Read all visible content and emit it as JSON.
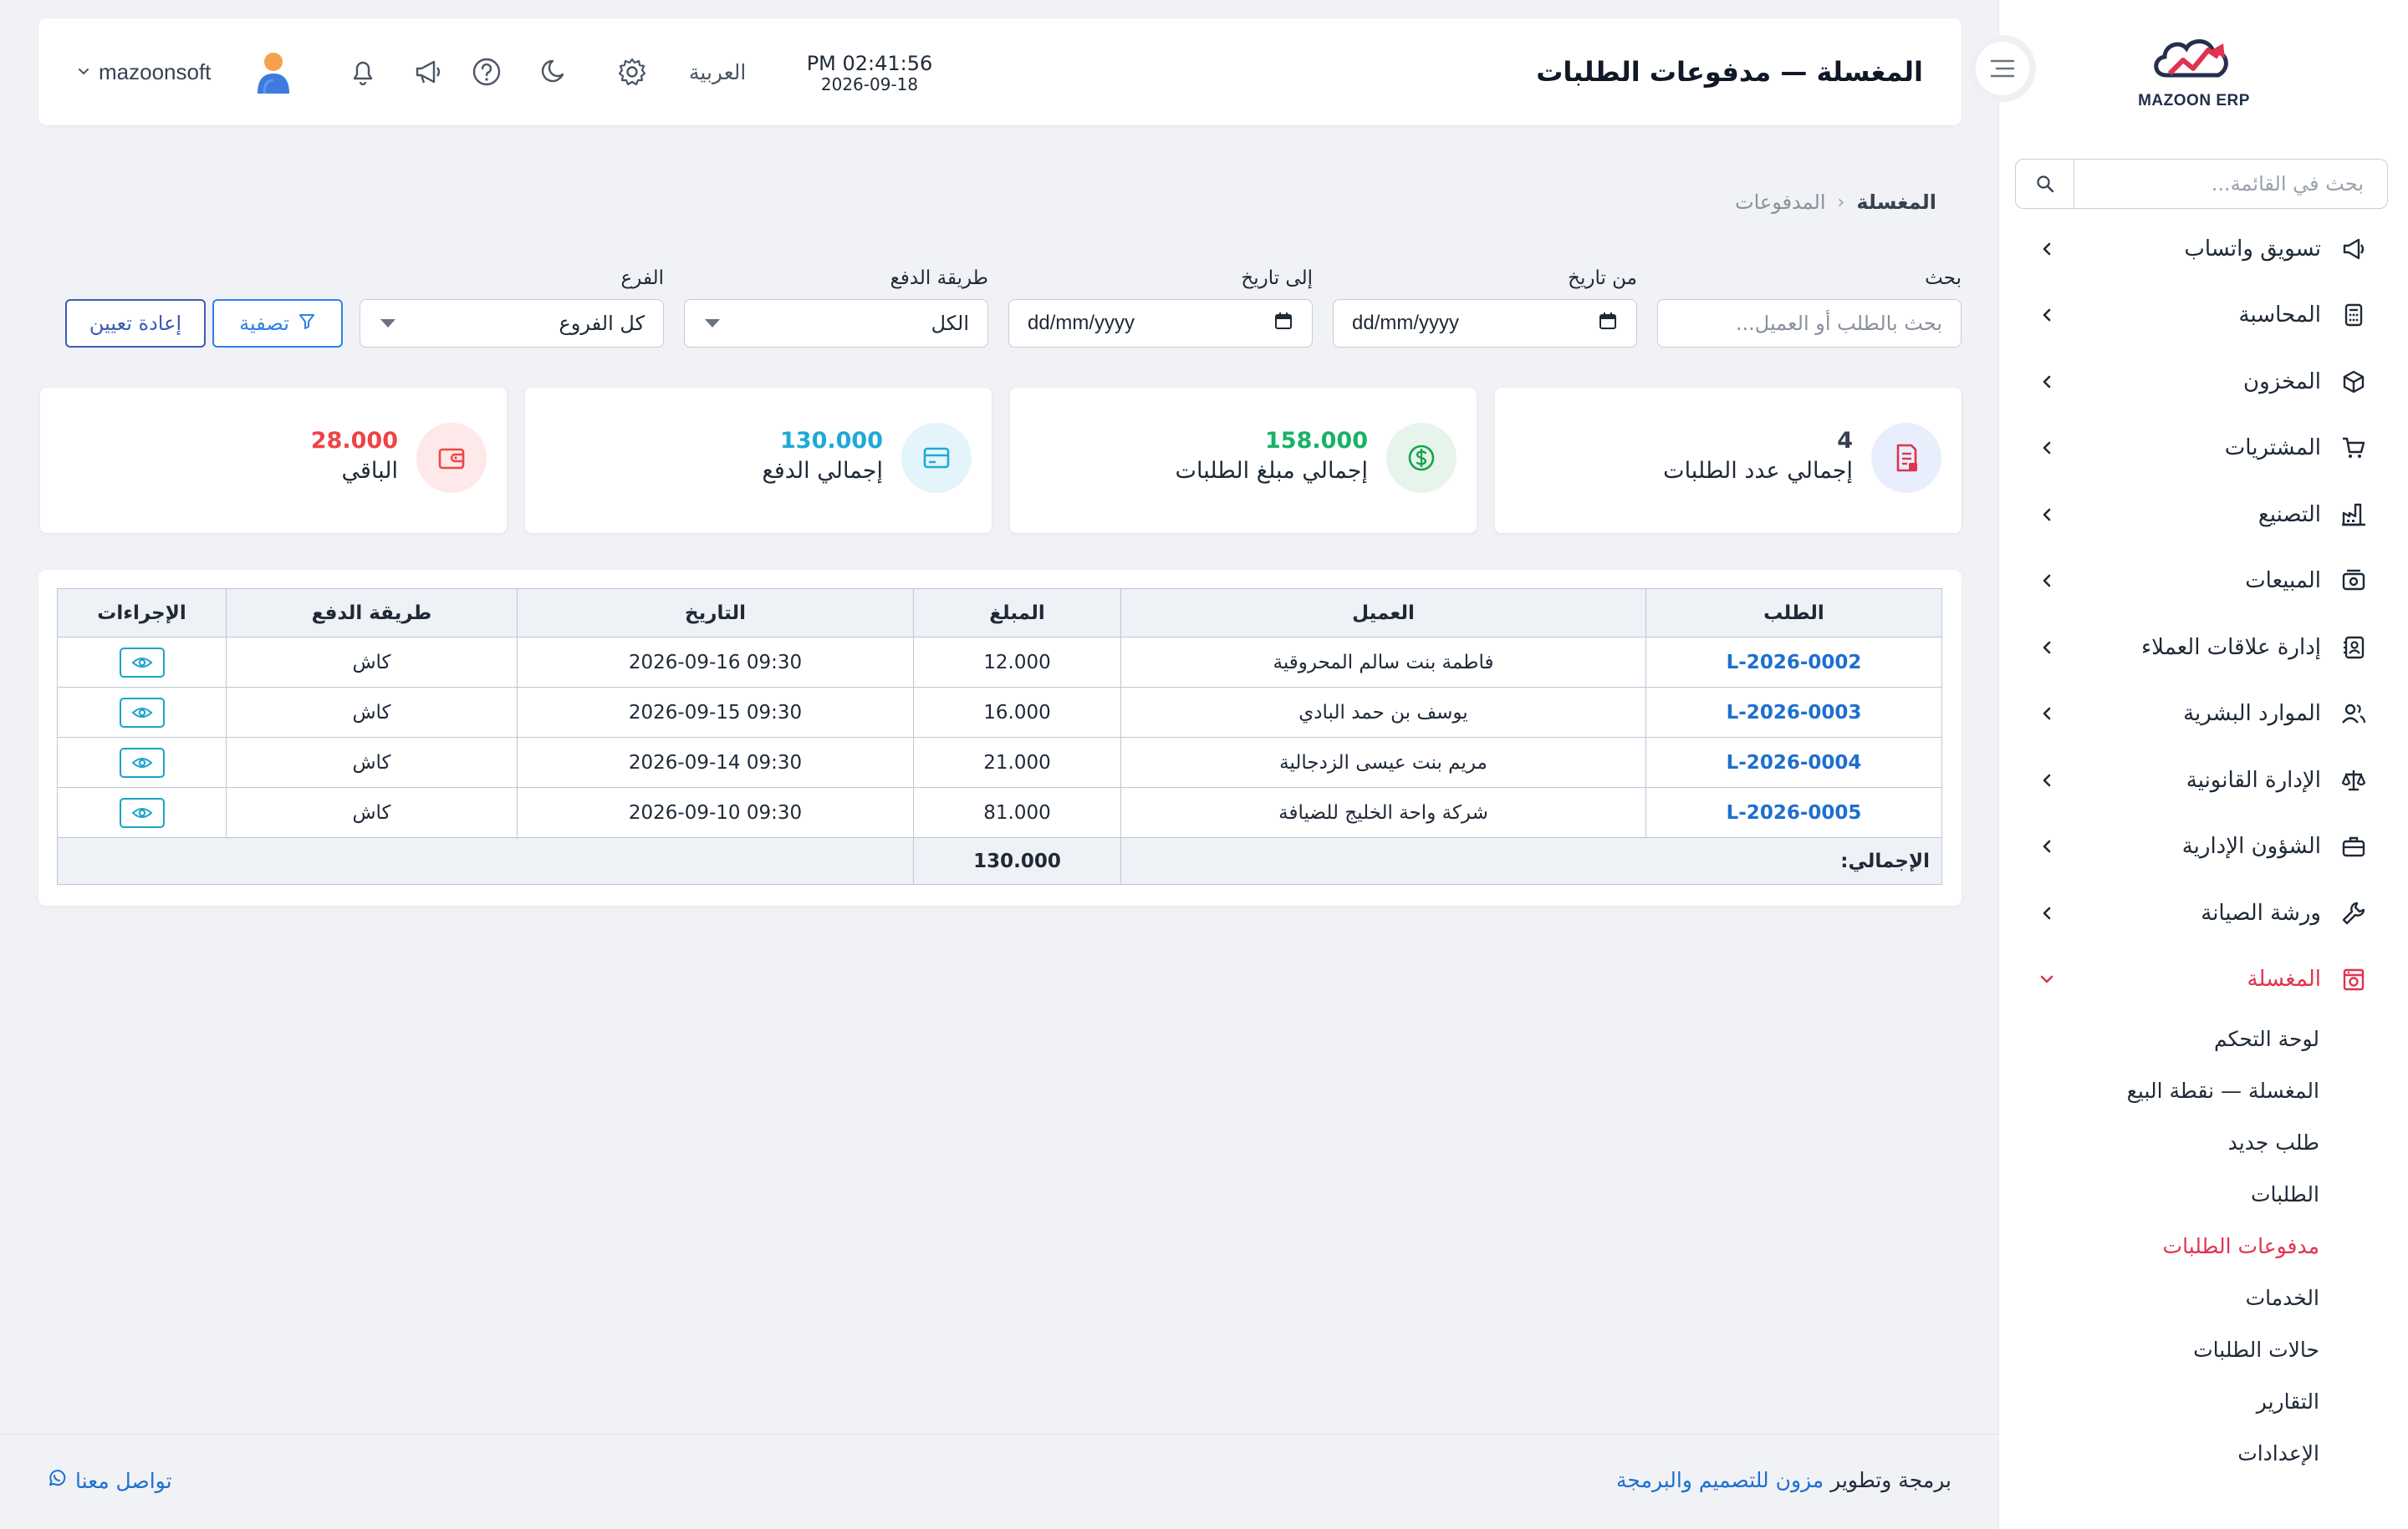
{
  "app": {
    "logo_text": "MAZOON ERP"
  },
  "sidebar": {
    "search_placeholder": "بحث في القائمة...",
    "items": [
      {
        "label": "تسويق واتساب",
        "icon": "megaphone-icon"
      },
      {
        "label": "المحاسبة",
        "icon": "calculator-icon"
      },
      {
        "label": "المخزون",
        "icon": "box-icon"
      },
      {
        "label": "المشتريات",
        "icon": "cart-icon"
      },
      {
        "label": "التصنيع",
        "icon": "factory-icon"
      },
      {
        "label": "المبيعات",
        "icon": "register-icon"
      },
      {
        "label": "إدارة علاقات العملاء",
        "icon": "contacts-icon"
      },
      {
        "label": "الموارد البشرية",
        "icon": "users-icon"
      },
      {
        "label": "الإدارة القانونية",
        "icon": "scale-icon"
      },
      {
        "label": "الشؤون الإدارية",
        "icon": "briefcase-icon"
      },
      {
        "label": "ورشة الصيانة",
        "icon": "wrench-icon"
      },
      {
        "label": "المغسلة",
        "icon": "laundry-icon"
      }
    ],
    "submenu": [
      "لوحة التحكم",
      "المغسلة — نقطة البيع",
      "طلب جديد",
      "الطلبات",
      "مدفوعات الطلبات",
      "الخدمات",
      "حالات الطلبات",
      "التقارير",
      "الإعدادات"
    ],
    "active_item": "المغسلة",
    "active_subitem": "مدفوعات الطلبات"
  },
  "header": {
    "title": "المغسلة — مدفوعات الطلبات",
    "time": "PM 02:41:56",
    "date": "2026-09-18",
    "language": "العربية",
    "username": "mazoonsoft"
  },
  "breadcrumb": {
    "home": "المغسلة",
    "separator": "‹",
    "current": "المدفوعات"
  },
  "filters": {
    "search": {
      "label": "بحث",
      "placeholder": "بحث بالطلب أو العميل..."
    },
    "from_date": {
      "label": "من تاريخ",
      "placeholder": "dd/mm/yyyy"
    },
    "to_date": {
      "label": "إلى تاريخ",
      "placeholder": "dd/mm/yyyy"
    },
    "payment_method": {
      "label": "طريقة الدفع",
      "value": "الكل"
    },
    "branch": {
      "label": "الفرع",
      "value": "كل الفروع"
    },
    "filter_button": "تصفية",
    "reset_button": "إعادة تعيين"
  },
  "stats": [
    {
      "label": "إجمالي عدد الطلبات",
      "value": "4",
      "color": "#374151",
      "icon": "invoice-icon",
      "icon_bg": "#e8eefb",
      "icon_color": "#e0334f"
    },
    {
      "label": "إجمالي مبلغ الطلبات",
      "value": "158.000",
      "color": "#16b364",
      "icon": "dollar-icon",
      "icon_bg": "#e6f4ec",
      "icon_color": "#16a34a"
    },
    {
      "label": "إجمالي الدفع",
      "value": "130.000",
      "color": "#1fa9d6",
      "icon": "card-icon",
      "icon_bg": "#e3f4fa",
      "icon_color": "#1fa9d6"
    },
    {
      "label": "الباقي",
      "value": "28.000",
      "color": "#ef4444",
      "icon": "wallet-icon",
      "icon_bg": "#fde8ea",
      "icon_color": "#ef4444"
    }
  ],
  "table": {
    "columns": [
      "الطلب",
      "العميل",
      "المبلغ",
      "التاريخ",
      "طريقة الدفع",
      "الإجراءات"
    ],
    "rows": [
      {
        "order": "L-2026-0002",
        "customer": "فاطمة بنت سالم المحروقية",
        "amount": "12.000",
        "date": "2026-09-16 09:30",
        "method": "كاش"
      },
      {
        "order": "L-2026-0003",
        "customer": "يوسف بن حمد البادي",
        "amount": "16.000",
        "date": "2026-09-15 09:30",
        "method": "كاش"
      },
      {
        "order": "L-2026-0004",
        "customer": "مريم بنت عيسى الزدجالية",
        "amount": "21.000",
        "date": "2026-09-14 09:30",
        "method": "كاش"
      },
      {
        "order": "L-2026-0005",
        "customer": "شركة واحة الخليج للضيافة",
        "amount": "81.000",
        "date": "2026-09-10 09:30",
        "method": "كاش"
      }
    ],
    "total_label": "الإجمالي:",
    "total_value": "130.000"
  },
  "footer": {
    "credit_prefix": "برمجة وتطوير",
    "credit_link": "مزون للتصميم والبرمجة",
    "contact": "تواصل معنا"
  }
}
